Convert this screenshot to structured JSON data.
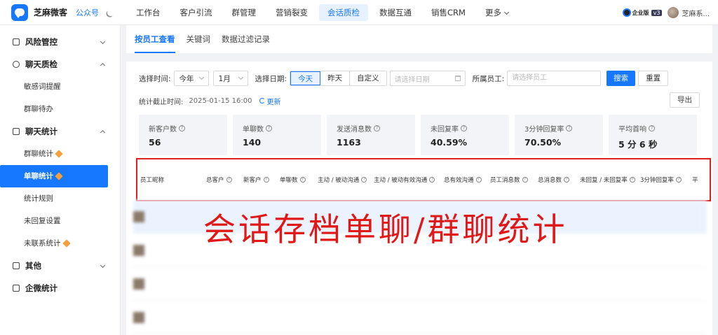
{
  "app": {
    "name": "芝麻微客",
    "account_link": "公众号"
  },
  "nav": {
    "items": [
      "工作台",
      "客户引流",
      "群管理",
      "营销裂变",
      "会话质检",
      "数据互通",
      "销售CRM",
      "更多"
    ],
    "active_index": 4
  },
  "topright": {
    "edition": "企业版",
    "version": "v3",
    "user": "芝麻系..."
  },
  "sidebar": {
    "groups": [
      {
        "label": "风险管控",
        "expanded": false
      },
      {
        "label": "聊天质检",
        "expanded": true,
        "items": [
          "敏感词提醒",
          "群聊待办"
        ]
      },
      {
        "label": "聊天统计",
        "expanded": true,
        "items": [
          "群聊统计",
          "单聊统计",
          "统计规则",
          "未回复设置",
          "未联系统计"
        ]
      },
      {
        "label": "其他",
        "expanded": false
      },
      {
        "label": "企微统计"
      }
    ],
    "active_item": "单聊统计"
  },
  "tabs": [
    "按员工查看",
    "关键词",
    "数据过滤记录"
  ],
  "filters": {
    "time_label": "选择时间:",
    "year_value": "今年",
    "month_value": "1月",
    "date_label": "选择日期:",
    "date_buttons": [
      "今天",
      "昨天",
      "自定义"
    ],
    "date_active": "今天",
    "date_placeholder": "请选择日期",
    "staff_label": "所属员工:",
    "staff_placeholder": "请选择员工",
    "search_button": "搜索",
    "reset_button": "重置"
  },
  "meta": {
    "cutoff_label": "统计截止时间:",
    "cutoff_time": "2025-01-15 16:00",
    "refresh": "更新",
    "export": "导出"
  },
  "stats": [
    {
      "label": "新客户数",
      "value": "56"
    },
    {
      "label": "单聊数",
      "value": "140"
    },
    {
      "label": "发送消息数",
      "value": "1163"
    },
    {
      "label": "未回复率",
      "value": "40.59%"
    },
    {
      "label": "3分钟回复率",
      "value": "70.50%"
    },
    {
      "label": "平均首响",
      "value": "5 分 6 秒"
    }
  ],
  "table": {
    "columns": [
      {
        "label": "员工昵称",
        "help": false
      },
      {
        "label": "总客户",
        "help": true
      },
      {
        "label": "新客户",
        "help": true
      },
      {
        "label": "单聊数",
        "help": true
      },
      {
        "label": "主动 / 被动沟通",
        "help": true
      },
      {
        "label": "主动 / 被动有效沟通",
        "help": true
      },
      {
        "label": "总有效沟通",
        "help": true
      },
      {
        "label": "员工消息数",
        "help": true
      },
      {
        "label": "总消息数",
        "help": true
      },
      {
        "label": "未回复 / 未回复率",
        "help": true
      },
      {
        "label": "3分钟回复率",
        "help": true
      },
      {
        "label": "平",
        "help": false
      }
    ]
  },
  "overlay_caption": "会话存档单聊/群聊统计",
  "colors": {
    "accent": "#1677ff",
    "highlight_box": "#e02020",
    "caption": "#e01818"
  }
}
